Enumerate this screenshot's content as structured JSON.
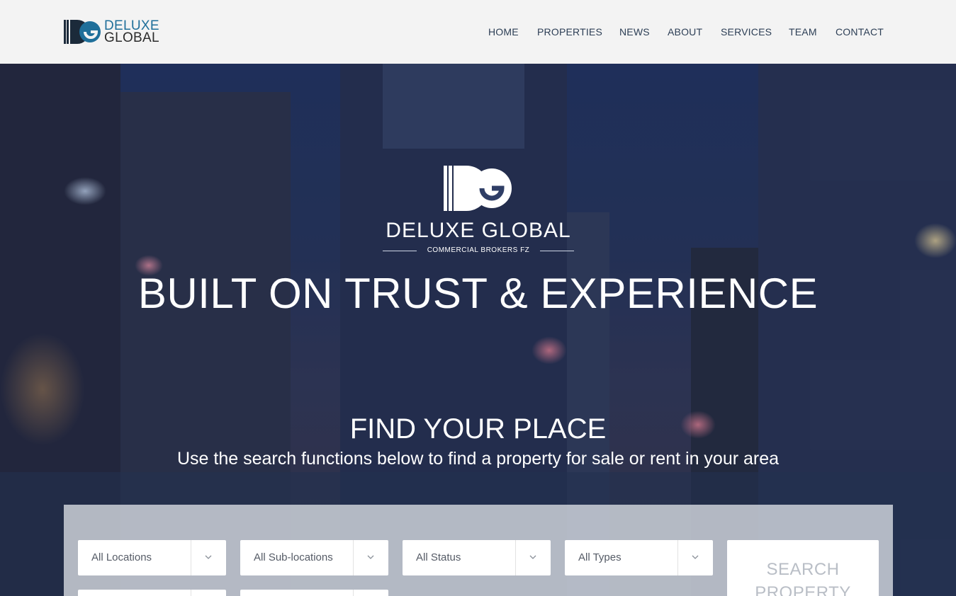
{
  "header": {
    "logo_line1": "DELUXE",
    "logo_line2": "GLOBAL",
    "nav": [
      "HOME",
      "PROPERTIES",
      "NEWS",
      "ABOUT",
      "SERVICES",
      "TEAM",
      "CONTACT"
    ]
  },
  "hero": {
    "brand": "DELUXE GLOBAL",
    "brand_sub": "COMMERCIAL BROKERS FZ",
    "title": "BUILT ON TRUST & EXPERIENCE",
    "find_title": "FIND YOUR PLACE",
    "find_subtitle": "Use the search functions below to find a property for sale or rent in your area"
  },
  "search": {
    "locations": "All Locations",
    "sublocations": "All Sub-locations",
    "status": "All Status",
    "types": "All Types",
    "button_line1": "SEARCH",
    "button_line2": "PROPERTY"
  },
  "colors": {
    "header_bg": "#f3f3f3",
    "nav_text": "#2c3e55",
    "logo_blue": "#1f6f9a",
    "hero_overlay": "#1f2f55"
  }
}
